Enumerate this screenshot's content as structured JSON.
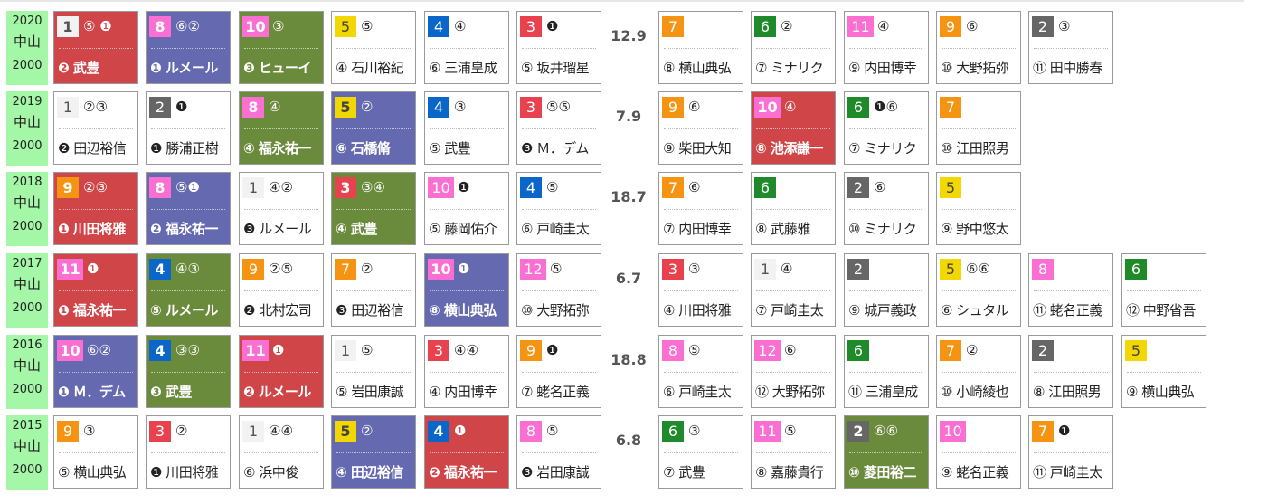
{
  "races": [
    {
      "year": "2020",
      "venue": "中山",
      "distance": "2000",
      "lap": "12.9",
      "horses": [
        {
          "num": "1",
          "marks": "⑤ ❶",
          "jockey": "❷ 武豊",
          "style": "red"
        },
        {
          "num": "8",
          "marks": "⑥②",
          "jockey": "❶ ルメール",
          "style": "blue"
        },
        {
          "num": "10",
          "marks": "③",
          "jockey": "❸ ヒューイ",
          "style": "green"
        },
        {
          "num": "5",
          "marks": "⑤",
          "jockey": "④ 石川裕紀",
          "style": "white"
        },
        {
          "num": "4",
          "marks": "④",
          "jockey": "⑥ 三浦皇成",
          "style": "white"
        },
        {
          "num": "3",
          "marks": "❶",
          "jockey": "⑤ 坂井瑠星",
          "style": "white"
        },
        {
          "num": "7",
          "marks": "",
          "jockey": "⑧ 横山典弘",
          "style": "white"
        },
        {
          "num": "6",
          "marks": "②",
          "jockey": "⑦ ミナリク",
          "style": "white"
        },
        {
          "num": "11",
          "marks": "④",
          "jockey": "⑨ 内田博幸",
          "style": "white"
        },
        {
          "num": "9",
          "marks": "⑥",
          "jockey": "⑩ 大野拓弥",
          "style": "white"
        },
        {
          "num": "2",
          "marks": "③",
          "jockey": "⑪ 田中勝春",
          "style": "white"
        }
      ]
    },
    {
      "year": "2019",
      "venue": "中山",
      "distance": "2000",
      "lap": "7.9",
      "horses": [
        {
          "num": "1",
          "marks": "②③",
          "jockey": "❷ 田辺裕信",
          "style": "white"
        },
        {
          "num": "2",
          "marks": "❶",
          "jockey": "❶ 勝浦正樹",
          "style": "white"
        },
        {
          "num": "8",
          "marks": "④",
          "jockey": "④ 福永祐一",
          "style": "green"
        },
        {
          "num": "5",
          "marks": "②",
          "jockey": "⑥ 石橋脩",
          "style": "blue"
        },
        {
          "num": "4",
          "marks": "③",
          "jockey": "⑤ 武豊",
          "style": "white"
        },
        {
          "num": "3",
          "marks": "⑤⑤",
          "jockey": "❸ Ｍ．デム",
          "style": "white"
        },
        {
          "num": "9",
          "marks": "⑥",
          "jockey": "⑨ 柴田大知",
          "style": "white"
        },
        {
          "num": "10",
          "marks": "④",
          "jockey": "⑧ 池添謙一",
          "style": "red"
        },
        {
          "num": "6",
          "marks": "❶⑥",
          "jockey": "⑦ ミナリク",
          "style": "white"
        },
        {
          "num": "7",
          "marks": "",
          "jockey": "⑩ 江田照男",
          "style": "white"
        }
      ]
    },
    {
      "year": "2018",
      "venue": "中山",
      "distance": "2000",
      "lap": "18.7",
      "horses": [
        {
          "num": "9",
          "marks": "②③",
          "jockey": "❶ 川田将雅",
          "style": "red"
        },
        {
          "num": "8",
          "marks": "⑤❶",
          "jockey": "❷ 福永祐一",
          "style": "blue"
        },
        {
          "num": "1",
          "marks": "④②",
          "jockey": "❸ ルメール",
          "style": "white"
        },
        {
          "num": "3",
          "marks": "③④",
          "jockey": "④ 武豊",
          "style": "green"
        },
        {
          "num": "10",
          "marks": "❶",
          "jockey": "⑤ 藤岡佑介",
          "style": "white"
        },
        {
          "num": "4",
          "marks": "⑤",
          "jockey": "⑥ 戸崎圭太",
          "style": "white"
        },
        {
          "num": "7",
          "marks": "⑥",
          "jockey": "⑦ 内田博幸",
          "style": "white"
        },
        {
          "num": "6",
          "marks": "",
          "jockey": "⑧ 武藤雅",
          "style": "white"
        },
        {
          "num": "2",
          "marks": "⑥",
          "jockey": "⑩ ミナリク",
          "style": "white"
        },
        {
          "num": "5",
          "marks": "",
          "jockey": "⑨ 野中悠太",
          "style": "white"
        }
      ]
    },
    {
      "year": "2017",
      "venue": "中山",
      "distance": "2000",
      "lap": "6.7",
      "horses": [
        {
          "num": "11",
          "marks": "❶",
          "jockey": "❶ 福永祐一",
          "style": "red"
        },
        {
          "num": "4",
          "marks": "④③",
          "jockey": "⑤ ルメール",
          "style": "green"
        },
        {
          "num": "9",
          "marks": "②⑤",
          "jockey": "❷ 北村宏司",
          "style": "white"
        },
        {
          "num": "7",
          "marks": "②",
          "jockey": "❸ 田辺裕信",
          "style": "white"
        },
        {
          "num": "10",
          "marks": "❶",
          "jockey": "⑧ 横山典弘",
          "style": "blue"
        },
        {
          "num": "12",
          "marks": "⑤",
          "jockey": "⑩ 大野拓弥",
          "style": "white"
        },
        {
          "num": "3",
          "marks": "③",
          "jockey": "④ 川田将雅",
          "style": "white"
        },
        {
          "num": "1",
          "marks": "④",
          "jockey": "⑦ 戸崎圭太",
          "style": "white"
        },
        {
          "num": "2",
          "marks": "",
          "jockey": "⑨ 城戸義政",
          "style": "white"
        },
        {
          "num": "5",
          "marks": "⑥⑥",
          "jockey": "⑥ シュタル",
          "style": "white"
        },
        {
          "num": "8",
          "marks": "",
          "jockey": "⑪ 蛯名正義",
          "style": "white"
        },
        {
          "num": "6",
          "marks": "",
          "jockey": "⑫ 中野省吾",
          "style": "white"
        }
      ]
    },
    {
      "year": "2016",
      "venue": "中山",
      "distance": "2000",
      "lap": "18.8",
      "horses": [
        {
          "num": "10",
          "marks": "⑥②",
          "jockey": "❶ Ｍ．デム",
          "style": "blue"
        },
        {
          "num": "4",
          "marks": "③③",
          "jockey": "❸ 武豊",
          "style": "green"
        },
        {
          "num": "11",
          "marks": "❶",
          "jockey": "❷ ルメール",
          "style": "red"
        },
        {
          "num": "1",
          "marks": "⑤",
          "jockey": "⑤ 岩田康誠",
          "style": "white"
        },
        {
          "num": "3",
          "marks": "④④",
          "jockey": "④ 内田博幸",
          "style": "white"
        },
        {
          "num": "9",
          "marks": "❶",
          "jockey": "⑦ 蛯名正義",
          "style": "white"
        },
        {
          "num": "8",
          "marks": "⑤",
          "jockey": "⑥ 戸崎圭太",
          "style": "white"
        },
        {
          "num": "12",
          "marks": "⑥",
          "jockey": "⑫ 大野拓弥",
          "style": "white"
        },
        {
          "num": "6",
          "marks": "",
          "jockey": "⑪ 三浦皇成",
          "style": "white"
        },
        {
          "num": "7",
          "marks": "②",
          "jockey": "⑩ 小崎綾也",
          "style": "white"
        },
        {
          "num": "2",
          "marks": "",
          "jockey": "⑧ 江田照男",
          "style": "white"
        },
        {
          "num": "5",
          "marks": "",
          "jockey": "⑨ 横山典弘",
          "style": "white"
        }
      ]
    },
    {
      "year": "2015",
      "venue": "中山",
      "distance": "2000",
      "lap": "6.8",
      "horses": [
        {
          "num": "9",
          "marks": "③",
          "jockey": "⑤ 横山典弘",
          "style": "white"
        },
        {
          "num": "3",
          "marks": "②",
          "jockey": "❶ 川田将雅",
          "style": "white"
        },
        {
          "num": "1",
          "marks": "④④",
          "jockey": "⑥ 浜中俊",
          "style": "white"
        },
        {
          "num": "5",
          "marks": "②",
          "jockey": "④ 田辺裕信",
          "style": "blue"
        },
        {
          "num": "4",
          "marks": "❶",
          "jockey": "❷ 福永祐一",
          "style": "red"
        },
        {
          "num": "8",
          "marks": "⑤",
          "jockey": "❸ 岩田康誠",
          "style": "white"
        },
        {
          "num": "6",
          "marks": "③",
          "jockey": "⑦ 武豊",
          "style": "white"
        },
        {
          "num": "11",
          "marks": "⑤",
          "jockey": "⑧ 嘉藤貴行",
          "style": "white"
        },
        {
          "num": "2",
          "marks": "⑥⑥",
          "jockey": "⑩ 菱田裕二",
          "style": "green"
        },
        {
          "num": "10",
          "marks": "",
          "jockey": "⑨ 蛯名正義",
          "style": "white"
        },
        {
          "num": "7",
          "marks": "❶",
          "jockey": "⑪ 戸崎圭太",
          "style": "white"
        }
      ]
    }
  ]
}
